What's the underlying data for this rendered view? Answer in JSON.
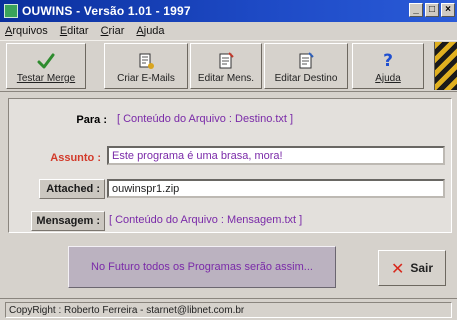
{
  "window": {
    "title": "OUWINS - Versão 1.01 - 1997",
    "minimize_glyph": "_",
    "maximize_glyph": "□",
    "close_glyph": "×"
  },
  "menu": {
    "items": [
      {
        "label": "Arquivos",
        "accel": "A",
        "rest": "rquivos"
      },
      {
        "label": "Editar",
        "accel": "E",
        "rest": "ditar"
      },
      {
        "label": "Criar",
        "accel": "C",
        "rest": "riar"
      },
      {
        "label": "Ajuda",
        "accel": "A",
        "rest": "juda"
      }
    ]
  },
  "toolbar": {
    "buttons": [
      {
        "label": "Testar Merge",
        "icon": "checkmark-icon"
      },
      {
        "label": "Criar E-Mails",
        "icon": "create-mail-icon"
      },
      {
        "label": "Editar Mens.",
        "icon": "edit-message-icon"
      },
      {
        "label": "Editar Destino",
        "icon": "edit-destination-icon"
      },
      {
        "label": "Ajuda",
        "icon": "help-question-icon"
      }
    ]
  },
  "form": {
    "para_label": "Para :",
    "para_value": "[ Conteúdo do Arquivo : Destino.txt ]",
    "assunto_label": "Assunto :",
    "assunto_value": "Este programa é uma brasa, mora!",
    "attached_label": "Attached :",
    "attached_value": "ouwinspr1.zip",
    "mensagem_label": "Mensagem :",
    "mensagem_value": "[ Conteúdo do Arquivo : Mensagem.txt ]"
  },
  "slogan": "No Futuro todos os Programas serão assim...",
  "exit_button": {
    "label": "Sair",
    "icon": "red-x-icon"
  },
  "status": {
    "text": "CopyRight : Roberto Ferreira - starnet@libnet.com.br"
  },
  "colors": {
    "title_bar": "#0a2f9c",
    "accent_purple": "#7a2aa8",
    "assunto_red": "#d23a2a"
  }
}
